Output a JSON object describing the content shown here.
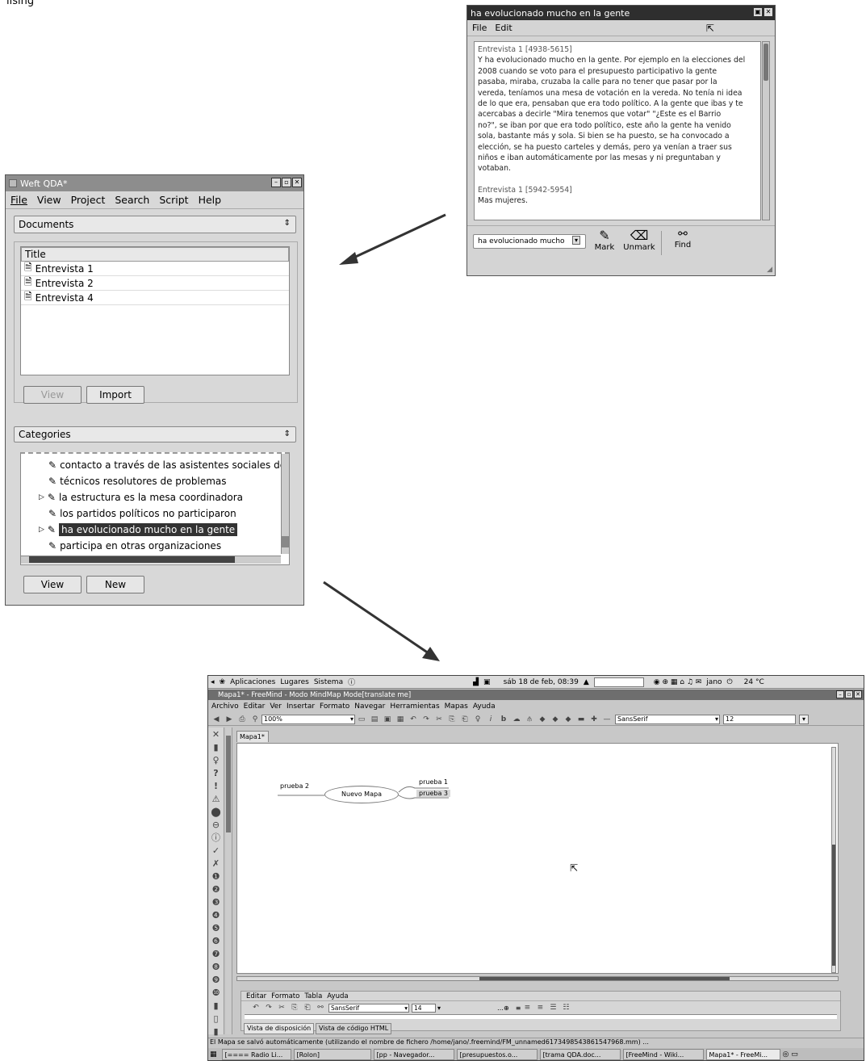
{
  "heading_text": "lising",
  "arrows": [
    "arrow-to-weftqda",
    "arrow-to-freemind"
  ],
  "coding_window": {
    "title": "ha evolucionado mucho en la gente",
    "menu": [
      "File",
      "Edit"
    ],
    "text_lines": [
      "Entrevista 1 [4938-5615]",
      "Y ha evolucionado mucho en la gente. Por ejemplo en la elecciones del",
      "2008 cuando se voto para el presupuesto participativo la gente",
      "pasaba, miraba, cruzaba la calle para no tener que pasar por la",
      "vereda, teníamos una mesa de votación en la vereda. No tenía ni idea",
      "de lo que era, pensaban que era todo político. A la gente que ibas y te",
      "acercabas a decirle \"Mira tenemos que votar\" \"¿Este es el Barrio",
      "no?\", se iban por que era todo político, este año la gente ha venido",
      "sola, bastante más y sola. Si bien se ha puesto, se ha convocado a",
      "elección, se ha puesto carteles y demás, pero ya venían a traer sus",
      "niños e iban automáticamente por las mesas y ni preguntaban y",
      "votaban.",
      "",
      "Entrevista 1 [5942-5954]",
      "Mas mujeres."
    ],
    "code_select": "ha evolucionado mucho",
    "mark_label": "Mark",
    "unmark_label": "Unmark",
    "find_label": "Find"
  },
  "weft": {
    "title": "Weft QDA*",
    "menu": [
      "File",
      "View",
      "Project",
      "Search",
      "Script",
      "Help"
    ],
    "documents_select": "Documents",
    "column_title": "Title",
    "documents": [
      "Entrevista 1",
      "Entrevista 2",
      "Entrevista 4"
    ],
    "view_label": "View",
    "import_label": "Import",
    "categories_select": "Categories",
    "categories": [
      "contacto a través de las asistentes sociales de la",
      "técnicos resolutores de problemas",
      "la estructura es la mesa coordinadora",
      "los partidos políticos no participaron",
      "ha evolucionado mucho en la gente",
      "participa en otras organizaciones"
    ],
    "view2_label": "View",
    "new_label": "New"
  },
  "freemind": {
    "panel_items": [
      "Aplicaciones",
      "Lugares",
      "Sistema"
    ],
    "clock": "sáb 18 de feb, 08:39",
    "user": "jano",
    "temp": "24 °C",
    "title": "Mapa1* - FreeMind - Modo MindMap Mode[translate me]",
    "menu": [
      "Archivo",
      "Editar",
      "Ver",
      "Insertar",
      "Formato",
      "Navegar",
      "Herramientas",
      "Mapas",
      "Ayuda"
    ],
    "zoom": "100%",
    "font": "SansSerif",
    "font_size": "12",
    "tab": "Mapa1*",
    "nodes": {
      "root": "Nuevo Mapa",
      "left": "prueba 2",
      "right1": "prueba 1",
      "right2": "prueba 3"
    },
    "editor_menu": [
      "Editar",
      "Formato",
      "Tabla",
      "Ayuda"
    ],
    "editor_font": "SansSerif",
    "editor_size": "14",
    "view_tab1": "Vista de disposición",
    "view_tab2": "Vista de código HTML",
    "status": "El Mapa se salvó automáticamente (utilizando el nombre de fichero /home/jano/.freemind/FM_unnamed6173498543861547968.mm) ...",
    "tasks": [
      "[==== Radio Li...",
      "[Rolon]",
      "[pp - Navegador...",
      "[presupuestos.o...",
      "[trama QDA.doc...",
      "[FreeMind - Wiki...",
      "Mapa1* - FreeMi..."
    ]
  }
}
